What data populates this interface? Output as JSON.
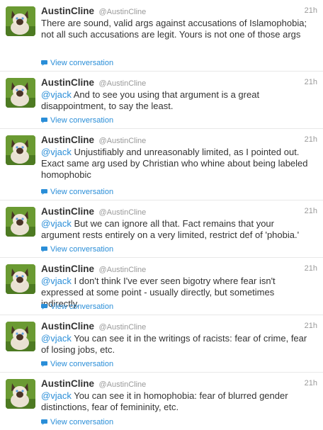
{
  "tweets": [
    {
      "display_name": "AustinCline",
      "handle": "@AustinCline",
      "time": "21h",
      "text": "There are sound, valid args against accusations of Islamophobia; not all such accusations are legit. Yours is not one of those args",
      "mention": "",
      "link_label": "View conversation"
    },
    {
      "display_name": "AustinCline",
      "handle": "@AustinCline",
      "time": "21h",
      "mention": "@vjack",
      "text": "And to see you using that argument is a great disappointment, to say the least.",
      "link_label": "View conversation"
    },
    {
      "display_name": "AustinCline",
      "handle": "@AustinCline",
      "time": "21h",
      "mention": "@vjack",
      "text": "Unjustifiably and unreasonably limited, as I pointed out. Exact same arg used by Christian who whine about being labeled homophobic",
      "link_label": "View conversation"
    },
    {
      "display_name": "AustinCline",
      "handle": "@AustinCline",
      "time": "21h",
      "mention": "@vjack",
      "text": "But we can ignore all that. Fact remains that your argument rests entirely on a very limited, restrict def of 'phobia.'",
      "link_label": "View conversation"
    },
    {
      "display_name": "AustinCline",
      "handle": "@AustinCline",
      "time": "21h",
      "mention": "@vjack",
      "text": "I don't think I've ever seen bigotry where fear isn't expressed at some point - usually directly, but sometimes indirectly.",
      "link_label": "View conversation"
    },
    {
      "display_name": "AustinCline",
      "handle": "@AustinCline",
      "time": "21h",
      "mention": "@vjack",
      "text": "You can see it in the writings of racists: fear of crime, fear of losing jobs, etc.",
      "link_label": "View conversation"
    },
    {
      "display_name": "AustinCline",
      "handle": "@AustinCline",
      "time": "21h",
      "mention": "@vjack",
      "text": "You can see it in homophobia: fear of blurred gender distinctions, fear of femininity, etc.",
      "link_label": "View conversation"
    }
  ],
  "colors": {
    "link": "#2a8ed8",
    "name": "#333333",
    "meta": "#999999"
  },
  "icons": {
    "conversation": "speech-bubble-icon",
    "avatar": "siamese-cat-on-grass"
  }
}
